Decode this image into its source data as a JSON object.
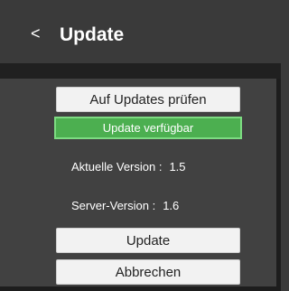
{
  "header": {
    "back_glyph": "<",
    "title": "Update"
  },
  "actions": {
    "check_label": "Auf Updates prüfen",
    "update_label": "Update",
    "cancel_label": "Abbrechen"
  },
  "status": {
    "text": "Update verfügbar",
    "color": "#4caf50"
  },
  "info": {
    "current_label": "Aktuelle Version :",
    "current_value": "1.5",
    "server_label": "Server-Version :",
    "server_value": "1.6"
  }
}
